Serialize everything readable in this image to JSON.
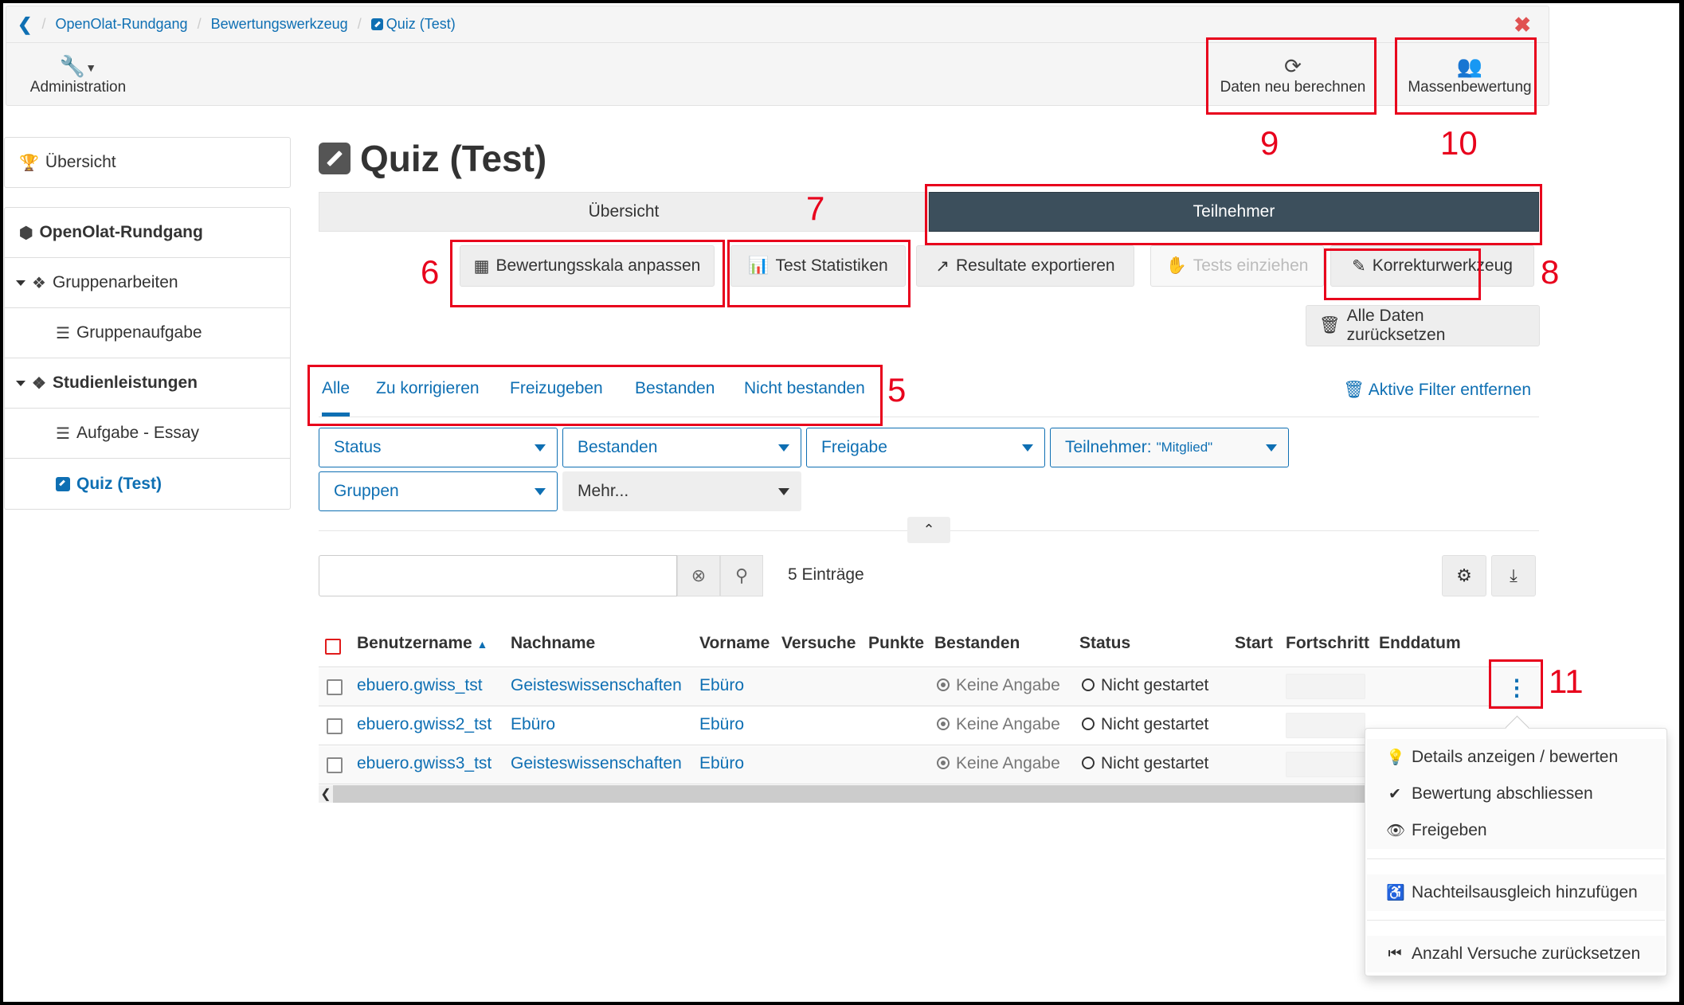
{
  "breadcrumb": {
    "back_icon": "chevron-left-icon",
    "items": [
      "OpenOlat-Rundgang",
      "Bewertungswerkzeug"
    ],
    "current": "Quiz (Test)",
    "close_icon": "close-icon"
  },
  "toolbar": {
    "administration": "Administration",
    "recalc": "Daten neu berechnen",
    "mass_assessment": "Massenbewertung"
  },
  "sidebar": {
    "overview": "Übersicht",
    "tree": [
      {
        "label": "OpenOlat-Rundgang",
        "icon": "cube-icon",
        "bold": true
      },
      {
        "label": "Gruppenarbeiten",
        "icon": "cubes-icon",
        "expanded": true
      },
      {
        "label": "Gruppenaufgabe",
        "icon": "task-icon"
      },
      {
        "label": "Studienleistungen",
        "icon": "cubes-icon",
        "expanded": true,
        "bold": true
      },
      {
        "label": "Aufgabe - Essay",
        "icon": "task-icon"
      },
      {
        "label": "Quiz (Test)",
        "icon": "edit-icon",
        "active": true
      }
    ]
  },
  "main": {
    "title": "Quiz (Test)",
    "tabs": [
      {
        "label": "Übersicht",
        "active": false
      },
      {
        "label": "Teilnehmer",
        "active": true
      }
    ],
    "buttons": {
      "grading_scale": "Bewertungsskala anpassen",
      "test_stats": "Test Statistiken",
      "export": "Resultate exportieren",
      "pull_tests": "Tests einziehen",
      "correction_tool": "Korrekturwerkzeug",
      "reset_all": "Alle Daten zurücksetzen"
    },
    "filter_tabs": [
      "Alle",
      "Zu korrigieren",
      "Freizugeben",
      "Bestanden",
      "Nicht bestanden"
    ],
    "active_filter_tab": "Alle",
    "remove_filters": "Aktive Filter entfernen",
    "filters": {
      "status": "Status",
      "passed": "Bestanden",
      "release": "Freigabe",
      "participant_label": "Teilnehmer:",
      "participant_value": "\"Mitglied\"",
      "groups": "Gruppen",
      "more": "Mehr..."
    },
    "search": {
      "value": "",
      "placeholder": ""
    },
    "entries": "5 Einträge",
    "table": {
      "columns": [
        "Benutzername",
        "Nachname",
        "Vorname",
        "Versuche",
        "Punkte",
        "Bestanden",
        "Status",
        "Start",
        "Fortschritt",
        "Enddatum"
      ],
      "sort_column": "Benutzername",
      "sort_dir": "asc",
      "rows": [
        {
          "username": "ebuero.gwiss_tst",
          "lastname": "Geisteswissenschaften",
          "firstname": "Ebüro",
          "attempts": "",
          "points": "",
          "passed": "Keine Angabe",
          "status": "Nicht gestartet",
          "start": "",
          "end": ""
        },
        {
          "username": "ebuero.gwiss2_tst",
          "lastname": "Ebüro",
          "firstname": "Ebüro",
          "attempts": "",
          "points": "",
          "passed": "Keine Angabe",
          "status": "Nicht gestartet",
          "start": "",
          "end": ""
        },
        {
          "username": "ebuero.gwiss3_tst",
          "lastname": "Geisteswissenschaften",
          "firstname": "Ebüro",
          "attempts": "",
          "points": "",
          "passed": "Keine Angabe",
          "status": "Nicht gestartet",
          "start": "",
          "end": ""
        }
      ]
    }
  },
  "context_menu": {
    "items": [
      {
        "label": "Details anzeigen / bewerten",
        "icon": "lightbulb-icon"
      },
      {
        "label": "Bewertung abschliessen",
        "icon": "check-icon"
      },
      {
        "label": "Freigeben",
        "icon": "eye-icon"
      },
      {
        "label": "Nachteilsausgleich hinzufügen",
        "icon": "accessibility-icon"
      },
      {
        "label": "Anzahl Versuche zurücksetzen",
        "icon": "step-backward-icon"
      }
    ]
  },
  "annotations": [
    "5",
    "6",
    "7",
    "8",
    "9",
    "10",
    "11"
  ],
  "colors": {
    "link": "#0e6fb3",
    "active_tab": "#3c4f5c",
    "annotation": "#e8001c",
    "close": "#e05252"
  }
}
